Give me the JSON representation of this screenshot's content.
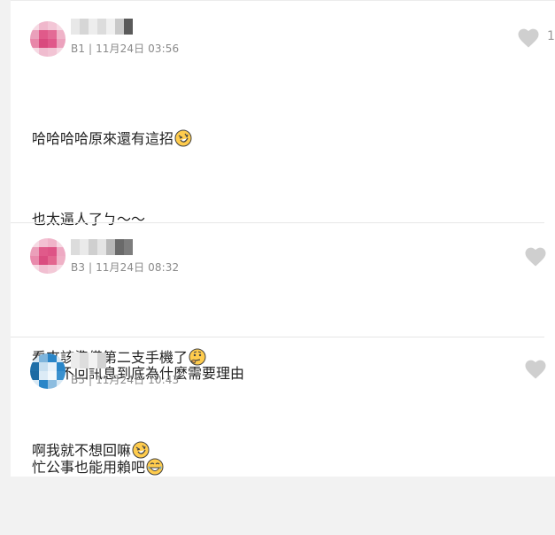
{
  "comments": [
    {
      "floor": "B1",
      "date": "11月24日 03:56",
      "like_count": "1",
      "lines": [
        "哈哈哈哈原來還有這招",
        "也太逼人了ㄅ～～",
        "",
        "不過不回訊息到底為什麼需要理由",
        "啊我就不想回嘛"
      ],
      "emoji": [
        "rofl-emoji",
        "rofl-emoji"
      ]
    },
    {
      "floor": "B3",
      "date": "11月24日 08:32",
      "lines": [
        "看來該準備第二支手機了"
      ],
      "emoji": [
        "thinking-emoji"
      ]
    },
    {
      "floor": "B5",
      "date": "11月24日 10:43",
      "lines": [
        "忙公事也能用賴吧"
      ],
      "emoji": [
        "joy-emoji"
      ]
    }
  ],
  "colors": {
    "avatar_pink": "#e05a8a",
    "avatar_blue": "#2a86c8",
    "heart": "#cfcfcf",
    "meta": "#8a8a8a"
  }
}
